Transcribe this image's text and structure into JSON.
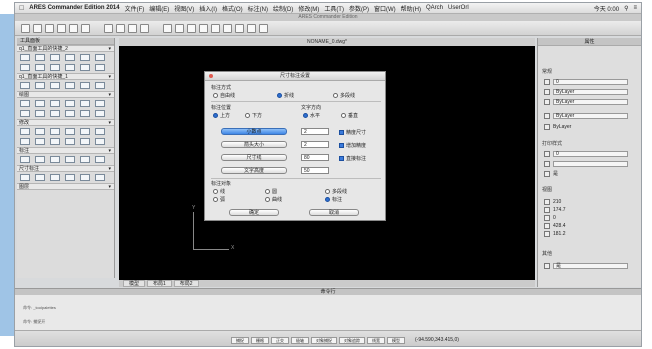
{
  "menubar": {
    "app_name": "ARES Commander Edition 2014",
    "items": [
      "文件(F)",
      "编辑(E)",
      "视图(V)",
      "插入(I)",
      "格式(O)",
      "标注(N)",
      "绘制(D)",
      "修改(M)",
      "工具(T)",
      "参数(P)",
      "窗口(W)",
      "帮助(H)",
      "QArch",
      "UserOrl"
    ],
    "right_text": "今天 0:00"
  },
  "titlebar": {
    "title": "ARES Commander Edition"
  },
  "drawing": {
    "tab_title": "NONAME_0.dwg*"
  },
  "left_panel": {
    "title": "工具面板",
    "sections": [
      "q1_直面工具的快捷_2",
      "q1_直面工具的快捷_1",
      "绘图",
      "修改",
      "标注",
      "尺寸标注",
      "图层"
    ]
  },
  "dialog": {
    "title": "尺寸标注设置",
    "group_a": "标注方式",
    "opt_a1": "自由线",
    "opt_a2": "折线",
    "opt_a3": "多段线",
    "group_b": "标注位置",
    "opt_b1": "上方",
    "opt_b2": "下方",
    "group_c": "文字方向",
    "opt_c1": "水平",
    "opt_c2": "垂直",
    "btn_1": "小数点",
    "btn_2": "箭头大小",
    "btn_3": "尺寸线",
    "btn_4": "文字高度",
    "val_1": "2",
    "val_2": "2",
    "val_3": "80",
    "val_4": "50",
    "chk_1": "精度尺寸",
    "chk_2": "增加精度",
    "chk_3": "直接标注",
    "group_d": "标注对象",
    "d1": "线",
    "d2": "圆",
    "d3": "多段线",
    "d4": "弧",
    "d5": "曲线",
    "d6": "标注",
    "ok": "确定",
    "cancel": "取消"
  },
  "layout_tabs": [
    "模型",
    "布局1",
    "布局2"
  ],
  "right_panel": {
    "title": "属性",
    "section_1": "常规",
    "layer": "0",
    "linetype": "ByLayer",
    "lineweight": "ByLayer",
    "color": "ByLayer",
    "section_2": "打印样式",
    "section_3": "视图",
    "values": [
      "210",
      "174.7",
      "0",
      "428.4",
      "181.2"
    ],
    "section_4": "其他",
    "ucs": "是"
  },
  "command": {
    "header": "命令行",
    "lines": [
      "命令: _toolpalettes",
      "命令: 捕捉开"
    ]
  },
  "statusbar": {
    "buttons": [
      "捕捉",
      "栅格",
      "正交",
      "极轴",
      "对象捕捉",
      "对象追踪",
      "线宽",
      "模型"
    ],
    "coordinates": "(-94.590,343.415,0)"
  },
  "colors": {
    "canvas": "#000000",
    "accent": "#3b7bdc",
    "frame": "#9fc4e6"
  }
}
